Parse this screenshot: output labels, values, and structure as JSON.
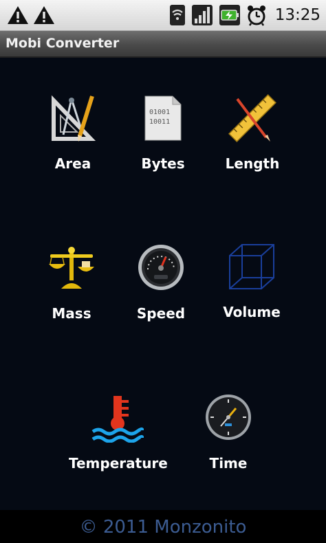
{
  "status_bar": {
    "time": "13:25",
    "icons": [
      "warning-icon",
      "warning-icon",
      "wifi-icon",
      "signal-icon",
      "battery-charging-icon",
      "alarm-clock-icon"
    ]
  },
  "app": {
    "title": "Mobi Converter"
  },
  "converters": [
    {
      "label": "Area",
      "icon": "drafting-tools-icon"
    },
    {
      "label": "Bytes",
      "icon": "binary-document-icon"
    },
    {
      "label": "Length",
      "icon": "ruler-pencil-icon"
    },
    {
      "label": "Mass",
      "icon": "balance-scale-icon"
    },
    {
      "label": "Speed",
      "icon": "speedometer-icon"
    },
    {
      "label": "Volume",
      "icon": "wireframe-cube-icon"
    },
    {
      "label": "Temperature",
      "icon": "thermometer-water-icon"
    },
    {
      "label": "Time",
      "icon": "clock-icon"
    }
  ],
  "footer": {
    "text": "© 2011 Monzonito"
  },
  "colors": {
    "background": "#050a14",
    "footer_text": "#3c5c92",
    "title_bar": "#4a4a4a"
  }
}
